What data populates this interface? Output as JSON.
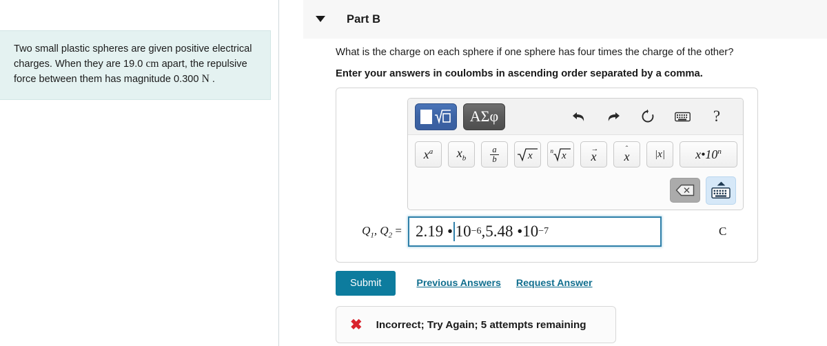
{
  "problem": {
    "text_part1": "Two small plastic spheres are given positive electrical charges. When they are 19.0 ",
    "unit_cm": "cm",
    "text_part2": " apart, the repulsive force between them has magnitude 0.300 ",
    "unit_N": "N",
    "text_part3": " ."
  },
  "part": {
    "title": "Part B",
    "caret": "caret-down-icon"
  },
  "question": {
    "prompt": "What is the charge on each sphere if one sphere has four times the charge of the other?",
    "instruction": "Enter your answers in coulombs in ascending order separated by a comma."
  },
  "toolbar": {
    "mode_math_label": "math-template-mode",
    "mode_greek_label": "ΑΣφ",
    "actions": [
      {
        "name": "undo-icon",
        "label": "Undo"
      },
      {
        "name": "redo-icon",
        "label": "Redo"
      },
      {
        "name": "reset-icon",
        "label": "Reset"
      },
      {
        "name": "keyboard-icon",
        "label": "Keyboard"
      },
      {
        "name": "help-icon",
        "label": "?"
      }
    ],
    "symbols": [
      {
        "name": "superscript-button",
        "label": "x^a"
      },
      {
        "name": "subscript-button",
        "label": "x_b"
      },
      {
        "name": "fraction-button",
        "num": "a",
        "den": "b"
      },
      {
        "name": "square-root-button",
        "label": "√x"
      },
      {
        "name": "nth-root-button",
        "label": "n√x"
      },
      {
        "name": "vector-button",
        "label": "x⃗"
      },
      {
        "name": "unit-vector-button",
        "label": "x̂"
      },
      {
        "name": "absolute-value-button",
        "label": "|x|"
      },
      {
        "name": "scientific-notation-button",
        "label": "x•10^n"
      }
    ],
    "backspace_label": "backspace-icon",
    "keyboard_toggle_label": "keyboard-toggle-icon"
  },
  "answer": {
    "label_q1": "Q",
    "label_q1_sub": "1",
    "label_q2": "Q",
    "label_q2_sub": "2",
    "equals": "=",
    "value_pre": "2.19 • ",
    "value_mantissa1": "10",
    "value_exp1": "−6",
    "value_mid": ",5.48 • ",
    "value_mantissa2": "10",
    "value_exp2": "−7",
    "full_value": "2.19 • 10^-6,5.48 • 10^-7",
    "unit": "C"
  },
  "actions": {
    "submit_label": "Submit",
    "previous_answers_label": "Previous Answers",
    "request_answer_label": "Request Answer"
  },
  "feedback": {
    "icon": "x-mark-icon",
    "symbol": "✖",
    "message": "Incorrect; Try Again; 5 attempts remaining"
  },
  "colors": {
    "problem_bg": "#e4f2f1",
    "submit": "#0d7c9e",
    "link": "#106e8e",
    "input_border": "#2e7fa8",
    "error": "#d9232d",
    "mode_active": "#3c63a4"
  }
}
